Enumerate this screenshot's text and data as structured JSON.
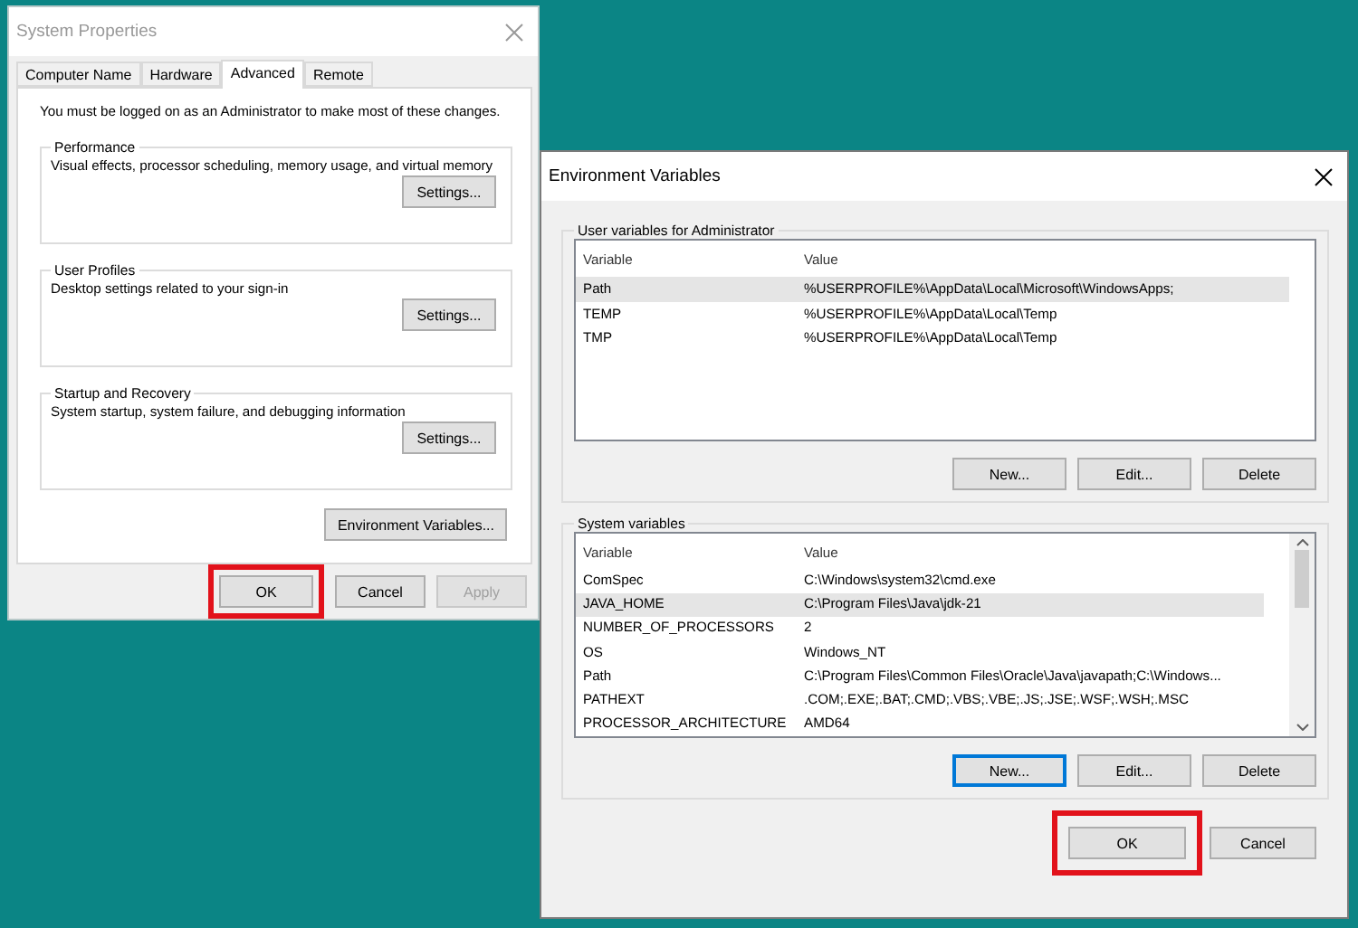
{
  "system_properties": {
    "title": "System Properties",
    "tabs": [
      {
        "label": "Computer Name",
        "selected": false
      },
      {
        "label": "Hardware",
        "selected": false
      },
      {
        "label": "Advanced",
        "selected": true
      },
      {
        "label": "Remote",
        "selected": false
      }
    ],
    "notice": "You must be logged on as an Administrator to make most of these changes.",
    "groups": [
      {
        "title": "Performance",
        "description": "Visual effects, processor scheduling, memory usage, and virtual memory",
        "button": "Settings..."
      },
      {
        "title": "User Profiles",
        "description": "Desktop settings related to your sign-in",
        "button": "Settings..."
      },
      {
        "title": "Startup and Recovery",
        "description": "System startup, system failure, and debugging information",
        "button": "Settings..."
      }
    ],
    "env_button": "Environment Variables...",
    "buttons": [
      {
        "label": "OK",
        "disabled": false,
        "highlighted": true
      },
      {
        "label": "Cancel",
        "disabled": false,
        "highlighted": false
      },
      {
        "label": "Apply",
        "disabled": true,
        "highlighted": false
      }
    ]
  },
  "environment_variables": {
    "title": "Environment Variables",
    "sections": [
      {
        "title": "User variables for Administrator",
        "columns": [
          "Variable",
          "Value"
        ],
        "scrollbar": false,
        "rows": [
          {
            "variable": "Path",
            "value": "%USERPROFILE%\\AppData\\Local\\Microsoft\\WindowsApps;",
            "selected": true
          },
          {
            "variable": "TEMP",
            "value": "%USERPROFILE%\\AppData\\Local\\Temp",
            "selected": false
          },
          {
            "variable": "TMP",
            "value": "%USERPROFILE%\\AppData\\Local\\Temp",
            "selected": false
          }
        ],
        "buttons": [
          {
            "label": "New...",
            "focused": false
          },
          {
            "label": "Edit...",
            "focused": false
          },
          {
            "label": "Delete",
            "focused": false
          }
        ]
      },
      {
        "title": "System variables",
        "columns": [
          "Variable",
          "Value"
        ],
        "scrollbar": true,
        "rows": [
          {
            "variable": "ComSpec",
            "value": "C:\\Windows\\system32\\cmd.exe",
            "selected": false
          },
          {
            "variable": "JAVA_HOME",
            "value": "C:\\Program Files\\Java\\jdk-21",
            "selected": true
          },
          {
            "variable": "NUMBER_OF_PROCESSORS",
            "value": "2",
            "selected": false
          },
          {
            "variable": "OS",
            "value": "Windows_NT",
            "selected": false
          },
          {
            "variable": "Path",
            "value": "C:\\Program Files\\Common Files\\Oracle\\Java\\javapath;C:\\Windows...",
            "selected": false
          },
          {
            "variable": "PATHEXT",
            "value": ".COM;.EXE;.BAT;.CMD;.VBS;.VBE;.JS;.JSE;.WSF;.WSH;.MSC",
            "selected": false
          },
          {
            "variable": "PROCESSOR_ARCHITECTURE",
            "value": "AMD64",
            "selected": false
          }
        ],
        "buttons": [
          {
            "label": "New...",
            "focused": true
          },
          {
            "label": "Edit...",
            "focused": false
          },
          {
            "label": "Delete",
            "focused": false
          }
        ]
      }
    ],
    "buttons": [
      {
        "label": "OK",
        "disabled": false,
        "highlighted": true
      },
      {
        "label": "Cancel",
        "disabled": false,
        "highlighted": false
      }
    ]
  }
}
